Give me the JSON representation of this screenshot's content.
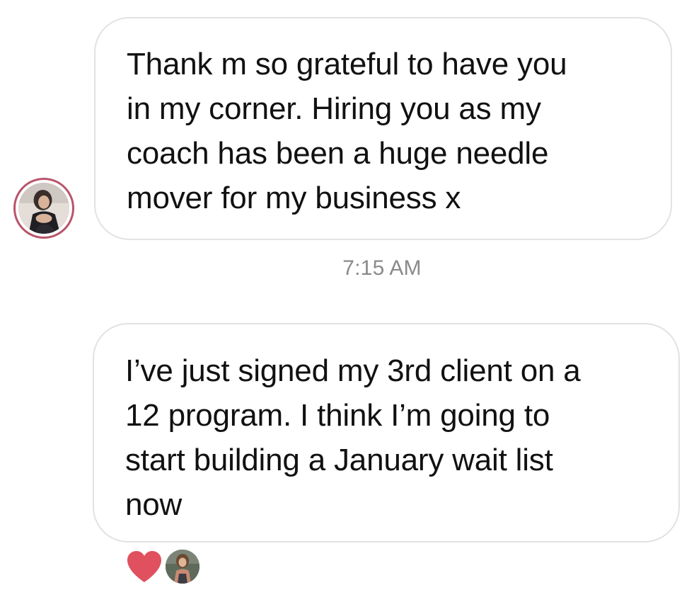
{
  "thread": {
    "messages": [
      {
        "lines": [
          "Thank m so grateful to have you",
          "in my corner. Hiring you as my",
          "coach has been a huge needle",
          "mover for my business x"
        ]
      },
      {
        "lines": [
          "I’ve just signed my 3rd client on a",
          "12 program. I think I’m going to",
          "start building a January wait list",
          "now"
        ]
      }
    ],
    "timestamp": "7:15 AM"
  },
  "reaction": {
    "icon": "heart-icon",
    "color": "#e0505e"
  },
  "colors": {
    "avatar_ring": "#b8546a",
    "bubble_border": "#e2e2e2",
    "timestamp": "#8a8a8a"
  }
}
